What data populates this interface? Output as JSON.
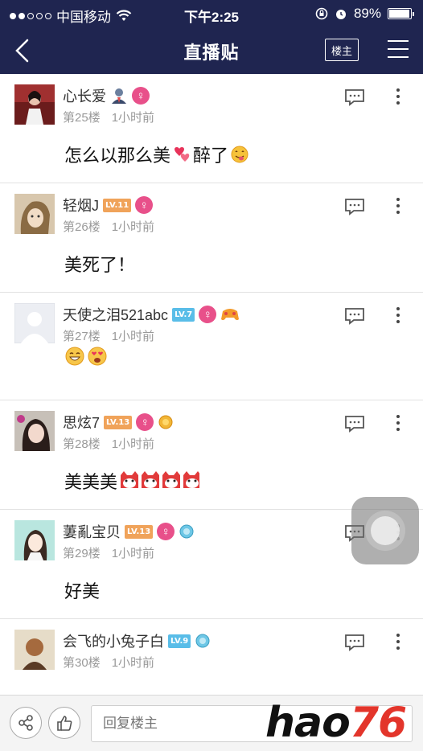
{
  "status_bar": {
    "carrier": "中国移动",
    "time": "下午2:25",
    "battery": "89%",
    "battery_level": 0.89
  },
  "nav": {
    "title": "直播贴",
    "owner_button": "楼主"
  },
  "posts": [
    {
      "username": "心长爱",
      "level": "",
      "floor": "第25楼",
      "time": "1小时前",
      "text": "怎么以那么美",
      "text2": "醉了",
      "level_color": ""
    },
    {
      "username": "轻烟J",
      "level": "LV.11",
      "floor": "第26楼",
      "time": "1小时前",
      "text": "美死了！",
      "text2": "",
      "level_color": "#f0a35a"
    },
    {
      "username": "天使之泪521abc",
      "level": "LV.7",
      "floor": "第27楼",
      "time": "1小时前",
      "text": "",
      "text2": "",
      "level_color": "#59bde8"
    },
    {
      "username": "思炫7",
      "level": "LV.13",
      "floor": "第28楼",
      "time": "1小时前",
      "text": "美美美",
      "text2": "",
      "level_color": "#f0a35a"
    },
    {
      "username": "萋亂宝贝",
      "level": "LV.13",
      "floor": "第29楼",
      "time": "1小时前",
      "text": "好美",
      "text2": "",
      "level_color": "#f0a35a"
    },
    {
      "username": "会飞的小兔子白",
      "level": "LV.9",
      "floor": "第30楼",
      "time": "1小时前",
      "text": "",
      "text2": "",
      "level_color": "#59bde8"
    }
  ],
  "reply": {
    "placeholder": "回复楼主"
  },
  "watermark": {
    "prefix": "hao",
    "suffix": "76"
  }
}
